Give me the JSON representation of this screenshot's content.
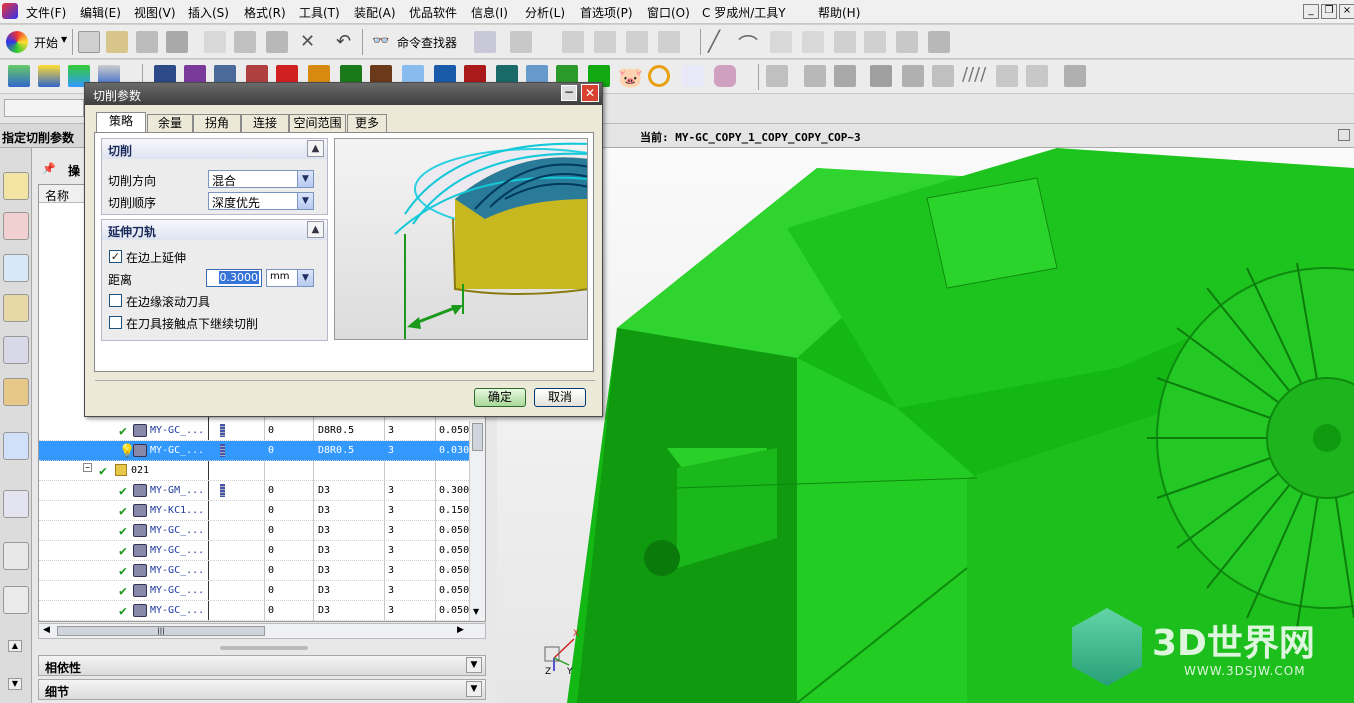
{
  "menu": {
    "items": [
      "文件(F)",
      "编辑(E)",
      "视图(V)",
      "插入(S)",
      "格式(R)",
      "工具(T)",
      "装配(A)",
      "优品软件",
      "信息(I)",
      "分析(L)",
      "首选项(P)",
      "窗口(O)",
      "C 罗成州/工具Y",
      "帮助(H)"
    ]
  },
  "toolbar": {
    "start_label": "开始",
    "cmd_finder_label": "命令查找器"
  },
  "nav": {
    "header": "指定切削参数",
    "ops_label": "操",
    "col_name": "名称"
  },
  "status": {
    "current_label": "当前: MY-GC_COPY_1_COPY_COPY_COP~3"
  },
  "table": {
    "rows": [
      {
        "name": "MY-GC_...",
        "c1": "0",
        "c2": "D8R0.5",
        "c3": "3",
        "c4": "0.050",
        "selected": false,
        "marker": "check",
        "tool": true,
        "indent": 1
      },
      {
        "name": "MY-GC_...",
        "c1": "0",
        "c2": "D8R0.5",
        "c3": "3",
        "c4": "0.030",
        "selected": true,
        "marker": "bulb",
        "tool": true,
        "indent": 1
      },
      {
        "name": "021",
        "c1": "",
        "c2": "",
        "c3": "",
        "c4": "",
        "selected": false,
        "marker": "group",
        "tool": false,
        "indent": 0
      },
      {
        "name": "MY-GM_...",
        "c1": "0",
        "c2": "D3",
        "c3": "3",
        "c4": "0.300",
        "selected": false,
        "marker": "check",
        "tool": true,
        "indent": 1
      },
      {
        "name": "MY-KC1...",
        "c1": "0",
        "c2": "D3",
        "c3": "3",
        "c4": "0.150",
        "selected": false,
        "marker": "check",
        "tool": false,
        "indent": 1
      },
      {
        "name": "MY-GC_...",
        "c1": "0",
        "c2": "D3",
        "c3": "3",
        "c4": "0.050",
        "selected": false,
        "marker": "check",
        "tool": false,
        "indent": 1
      },
      {
        "name": "MY-GC_...",
        "c1": "0",
        "c2": "D3",
        "c3": "3",
        "c4": "0.050",
        "selected": false,
        "marker": "check",
        "tool": false,
        "indent": 1
      },
      {
        "name": "MY-GC_...",
        "c1": "0",
        "c2": "D3",
        "c3": "3",
        "c4": "0.050",
        "selected": false,
        "marker": "check",
        "tool": false,
        "indent": 1
      },
      {
        "name": "MY-GC_...",
        "c1": "0",
        "c2": "D3",
        "c3": "3",
        "c4": "0.050",
        "selected": false,
        "marker": "check",
        "tool": false,
        "indent": 1
      },
      {
        "name": "MY-GC_...",
        "c1": "0",
        "c2": "D3",
        "c3": "3",
        "c4": "0.050",
        "selected": false,
        "marker": "check",
        "tool": false,
        "indent": 1
      }
    ]
  },
  "panels": {
    "dependency": "相依性",
    "details": "细节"
  },
  "dialog": {
    "title": "切削参数",
    "tabs": [
      "策略",
      "余量",
      "拐角",
      "连接",
      "空间范围",
      "更多"
    ],
    "cut_group": {
      "title": "切削",
      "direction_label": "切削方向",
      "direction_value": "混合",
      "order_label": "切削顺序",
      "order_value": "深度优先"
    },
    "extend_group": {
      "title": "延伸刀轨",
      "extend_on_edge": "在边上延伸",
      "extend_on_edge_checked": true,
      "distance_label": "距离",
      "distance_value": "0.3000",
      "distance_unit": "mm",
      "roll_tool": "在边缘滚动刀具",
      "roll_tool_checked": false,
      "continue_cut": "在刀具接触点下继续切削",
      "continue_cut_checked": false
    },
    "ok_label": "确定",
    "cancel_label": "取消"
  },
  "watermark": {
    "brand": "3D世界网",
    "url": "WWW.3DSJW.COM"
  },
  "triad": {
    "x": "X",
    "y": "Y",
    "z": "Z"
  },
  "colors": {
    "model_green": "#22cc22",
    "selection_blue": "#3399ff",
    "dialog_bg": "#ece9d8"
  }
}
